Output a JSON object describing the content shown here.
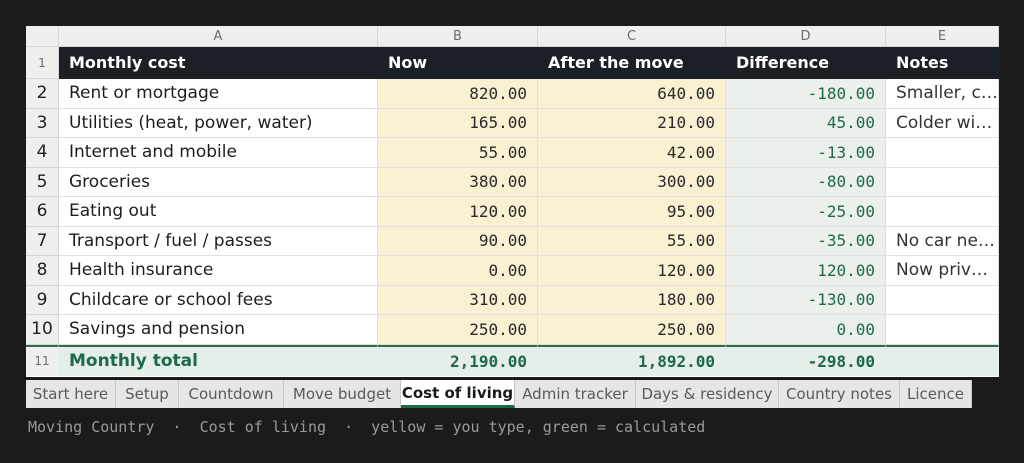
{
  "columns": [
    "A",
    "B",
    "C",
    "D",
    "E"
  ],
  "header": {
    "row_number": "1",
    "cells": [
      "Monthly cost",
      "Now",
      "After the move",
      "Difference",
      "Notes"
    ]
  },
  "rows": [
    {
      "num": "2",
      "label": "Rent or mortgage",
      "now": "820.00",
      "after": "640.00",
      "diff": "-180.00",
      "note": "Smaller, c…"
    },
    {
      "num": "3",
      "label": "Utilities (heat, power, water)",
      "now": "165.00",
      "after": "210.00",
      "diff": "45.00",
      "note": "Colder wi…"
    },
    {
      "num": "4",
      "label": "Internet and mobile",
      "now": "55.00",
      "after": "42.00",
      "diff": "-13.00",
      "note": ""
    },
    {
      "num": "5",
      "label": "Groceries",
      "now": "380.00",
      "after": "300.00",
      "diff": "-80.00",
      "note": ""
    },
    {
      "num": "6",
      "label": "Eating out",
      "now": "120.00",
      "after": "95.00",
      "diff": "-25.00",
      "note": ""
    },
    {
      "num": "7",
      "label": "Transport / fuel / passes",
      "now": "90.00",
      "after": "55.00",
      "diff": "-35.00",
      "note": "No car ne…"
    },
    {
      "num": "8",
      "label": "Health insurance",
      "now": "0.00",
      "after": "120.00",
      "diff": "120.00",
      "note": "Now priv…"
    },
    {
      "num": "9",
      "label": "Childcare or school fees",
      "now": "310.00",
      "after": "180.00",
      "diff": "-130.00",
      "note": ""
    },
    {
      "num": "10",
      "label": "Savings and pension",
      "now": "250.00",
      "after": "250.00",
      "diff": "0.00",
      "note": ""
    }
  ],
  "total": {
    "num": "11",
    "label": "Monthly total",
    "now": "2,190.00",
    "after": "1,892.00",
    "diff": "-298.00",
    "note": ""
  },
  "tabs": [
    "Start here",
    "Setup",
    "Countdown",
    "Move budget",
    "Cost of living",
    "Admin tracker",
    "Days & residency",
    "Country notes",
    "Licence"
  ],
  "active_tab": "Cost of living",
  "caption": "Moving Country  ·  Cost of living  ·  yellow = you type, green = calculated",
  "colors": {
    "input_fill": "#faf0d2",
    "calc_fill": "#ecf0ec",
    "accent_green": "#1d6b45",
    "header_fill": "#1b1f26"
  }
}
